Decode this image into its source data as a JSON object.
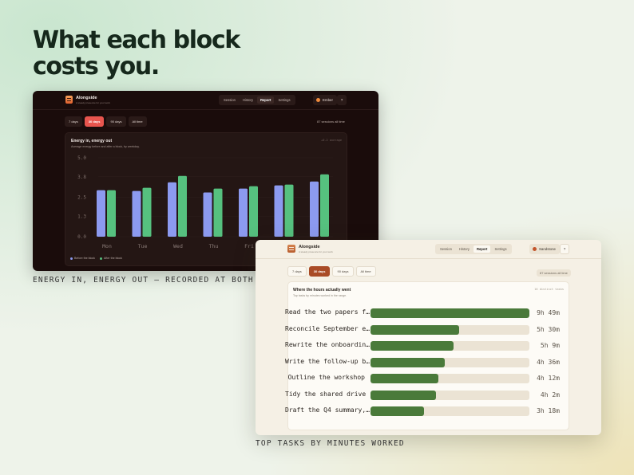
{
  "headline": {
    "line1": "What each block",
    "line2": "costs you."
  },
  "captions": {
    "energy": "ENERGY IN, ENERGY OUT — RECORDED AT BOTH ENDS",
    "tasks": "TOP TASKS BY MINUTES WORKED"
  },
  "dark_window": {
    "app_name": "Alongside",
    "tagline": "A steady presence for your work",
    "nav": [
      "Session",
      "History",
      "Report",
      "Settings"
    ],
    "nav_active": "Report",
    "theme_label": "Ember",
    "help_label": "?",
    "filters": [
      "7 days",
      "30 days",
      "90 days",
      "All time"
    ],
    "filter_active": "30 days",
    "sessions_label": "87 sessions all time",
    "card": {
      "title": "Energy in, energy out",
      "subtitle": "Average energy before and after a block, by weekday.",
      "average_note": "+0.2 average"
    },
    "legend": [
      "Before the block",
      "After the block"
    ],
    "colors": {
      "before": "#8c9af0",
      "after": "#56c17f",
      "accent": "#e8554e"
    }
  },
  "chart_data": {
    "type": "bar",
    "categories": [
      "Mon",
      "Tue",
      "Wed",
      "Thu",
      "Fri",
      "Sat",
      "Sun"
    ],
    "series": [
      {
        "name": "Before the block",
        "values": [
          2.95,
          2.9,
          3.45,
          2.8,
          3.05,
          3.25,
          3.5
        ]
      },
      {
        "name": "After the block",
        "values": [
          2.95,
          3.1,
          3.85,
          3.05,
          3.2,
          3.3,
          3.95
        ]
      }
    ],
    "yticks": [
      "0.0",
      "1.3",
      "2.5",
      "3.8",
      "5.0"
    ],
    "ylim": [
      0,
      5
    ],
    "xlabel": "",
    "ylabel": "",
    "grid": true
  },
  "light_window": {
    "app_name": "Alongside",
    "tagline": "A steady presence for your work",
    "nav": [
      "Session",
      "History",
      "Report",
      "Settings"
    ],
    "nav_active": "Report",
    "theme_label": "Sandstone",
    "help_label": "?",
    "filters": [
      "7 days",
      "30 days",
      "90 days",
      "All time"
    ],
    "filter_active": "30 days",
    "sessions_label": "87 sessions all time",
    "card": {
      "title": "Where the hours actually went",
      "subtitle": "Top tasks by minutes worked in the range.",
      "count_note": "16 distinct tasks"
    },
    "tasks": [
      {
        "name": "Read the two papers f…",
        "time": "9h 49m",
        "minutes": 589
      },
      {
        "name": "Reconcile September e…",
        "time": "5h 30m",
        "minutes": 330
      },
      {
        "name": "Rewrite the onboardin…",
        "time": "5h 9m",
        "minutes": 309
      },
      {
        "name": "Write the follow-up b…",
        "time": "4h 36m",
        "minutes": 276
      },
      {
        "name": "Outline the workshop",
        "time": "4h 12m",
        "minutes": 252
      },
      {
        "name": "Tidy the shared drive",
        "time": "4h 2m",
        "minutes": 242
      },
      {
        "name": "Draft the Q4 summary,…",
        "time": "3h 18m",
        "minutes": 198
      }
    ],
    "colors": {
      "bar": "#4a7a3a",
      "track": "#ebe3d4",
      "accent": "#a94b26"
    }
  }
}
